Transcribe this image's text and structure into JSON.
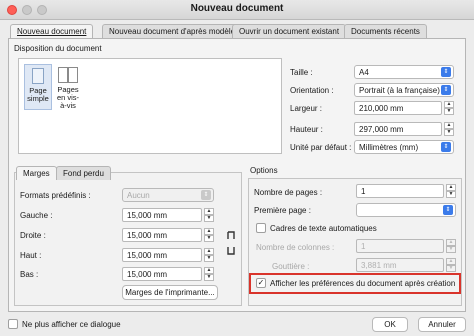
{
  "window": {
    "title": "Nouveau document"
  },
  "tabs": [
    {
      "label": "Nouveau document"
    },
    {
      "label": "Nouveau document d'après modèle"
    },
    {
      "label": "Ouvrir un document existant"
    },
    {
      "label": "Documents récents"
    }
  ],
  "layout_section": {
    "title": "Disposition du document",
    "choices": [
      {
        "label": "Page simple"
      },
      {
        "label": "Pages en vis-à-vis"
      }
    ]
  },
  "page_props": {
    "size_label": "Taille :",
    "size_value": "A4",
    "orientation_label": "Orientation :",
    "orientation_value": "Portrait (à la française)",
    "width_label": "Largeur :",
    "width_value": "210,000 mm",
    "height_label": "Hauteur :",
    "height_value": "297,000 mm",
    "unit_label": "Unité par défaut :",
    "unit_value": "Millimètres (mm)"
  },
  "margins": {
    "tabs": [
      {
        "label": "Marges"
      },
      {
        "label": "Fond perdu"
      }
    ],
    "preset_label": "Formats prédéfinis :",
    "preset_value": "Aucun",
    "left_label": "Gauche :",
    "left_value": "15,000 mm",
    "right_label": "Droite :",
    "right_value": "15,000 mm",
    "top_label": "Haut :",
    "top_value": "15,000 mm",
    "bottom_label": "Bas :",
    "bottom_value": "15,000 mm",
    "printer_button": "Marges de l'imprimante..."
  },
  "options": {
    "title": "Options",
    "pages_count_label": "Nombre de pages :",
    "pages_count_value": "1",
    "first_page_label": "Première page :",
    "auto_frames_label": "Cadres de texte automatiques",
    "columns_label": "Nombre de colonnes :",
    "columns_value": "1",
    "gutter_label": "Gouttière :",
    "gutter_value": "3,881 mm",
    "show_prefs_label": "Afficher les préférences du document après création",
    "show_prefs_checked": true
  },
  "footer": {
    "dont_show_label": "Ne plus afficher ce dialogue",
    "ok_label": "OK",
    "cancel_label": "Annuler"
  }
}
